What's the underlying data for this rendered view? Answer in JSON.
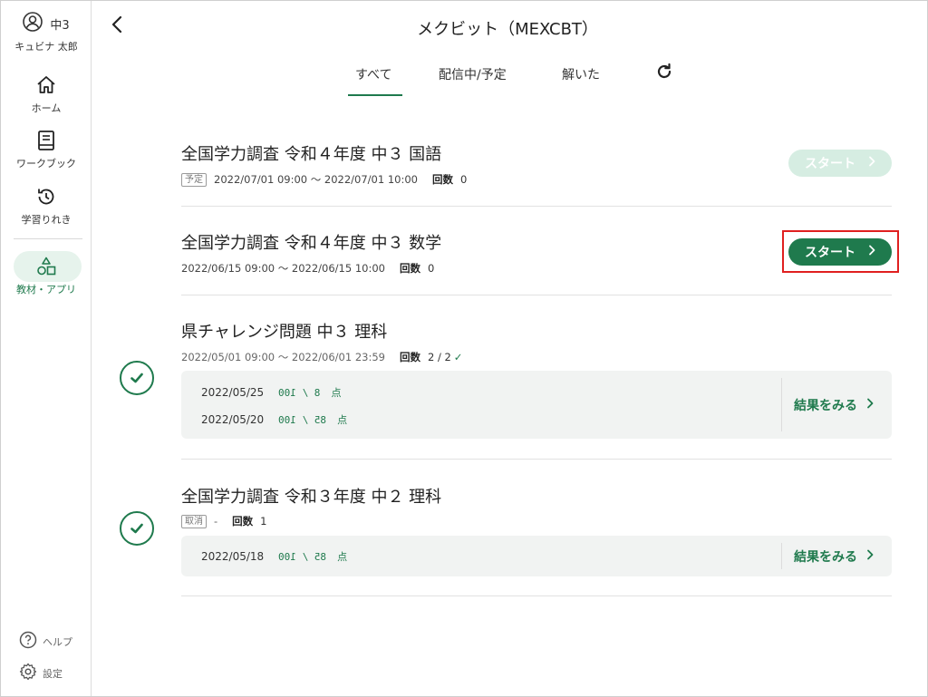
{
  "sidebar": {
    "user": {
      "grade": "中3",
      "name": "キュビナ 太郎"
    },
    "items": [
      {
        "label": "ホーム",
        "icon": "home-icon"
      },
      {
        "label": "ワークブック",
        "icon": "book-icon"
      },
      {
        "label": "学習りれき",
        "icon": "history-icon"
      },
      {
        "label": "教材・アプリ",
        "icon": "shapes-icon",
        "active": true
      }
    ],
    "help_label": "ヘルプ",
    "settings_label": "設定"
  },
  "header": {
    "title": "メクビット（MEXCBT）",
    "tabs": [
      {
        "label": "すべて",
        "active": true
      },
      {
        "label": "配信中/予定"
      },
      {
        "label": "解いた"
      }
    ]
  },
  "items": [
    {
      "title": "全国学力調査 令和４年度 中３ 国語",
      "tag": "予定",
      "period": "2022/07/01 09:00 〜 2022/07/01 10:00",
      "count_label": "回数",
      "count": "0",
      "button": "スタート",
      "button_state": "disabled"
    },
    {
      "title": "全国学力調査 令和４年度 中３ 数学",
      "period": "2022/06/15 09:00 〜 2022/06/15 10:00",
      "count_label": "回数",
      "count": "0",
      "button": "スタート",
      "button_state": "enabled"
    },
    {
      "title": "県チャレンジ問題 中３ 理科",
      "period": "2022/05/01 09:00 〜 2022/06/01 23:59",
      "count_label": "回数",
      "count": "2 / 2",
      "completed": true,
      "results": [
        {
          "date": "2022/05/25",
          "score": "8 / 100",
          "unit": "点"
        },
        {
          "date": "2022/05/20",
          "score": "85 / 100",
          "unit": "点"
        }
      ],
      "results_link": "結果をみる"
    },
    {
      "title": "全国学力調査 令和３年度 中２ 理科",
      "tag": "取消",
      "period": "-",
      "count_label": "回数",
      "count": "1",
      "completed": true,
      "results": [
        {
          "date": "2022/05/18",
          "score": "85 / 100",
          "unit": "点"
        }
      ],
      "results_link": "結果をみる"
    }
  ],
  "colors": {
    "accent": "#1f7a4d",
    "accent_light": "#d6ede2",
    "highlight": "#e02020"
  }
}
